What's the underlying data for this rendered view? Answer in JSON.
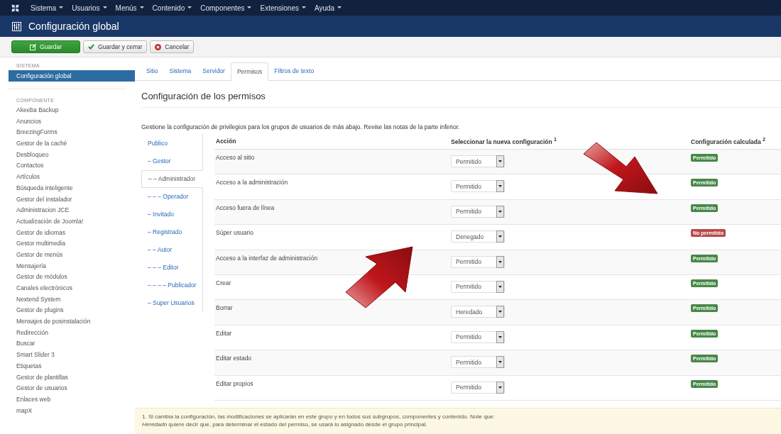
{
  "menu": [
    "Sistema",
    "Usuarios",
    "Menús",
    "Contenido",
    "Componentes",
    "Extensiones",
    "Ayuda"
  ],
  "header": {
    "title": "Configuración global"
  },
  "toolbar": [
    {
      "label": "Guardar",
      "kind": "primary"
    },
    {
      "label": "Guardar y cerrar",
      "kind": "check"
    },
    {
      "label": "Cancelar",
      "kind": "cancel"
    }
  ],
  "sidebar": [
    {
      "heading": "SISTEMA",
      "items": [
        {
          "label": "Configuración global",
          "selected": true
        }
      ]
    },
    {
      "heading": "COMPONENTE",
      "items": [
        {
          "label": "Akeeba Backup",
          "selected": false
        },
        {
          "label": "Anuncios",
          "selected": false
        },
        {
          "label": "BreezingForms",
          "selected": false
        },
        {
          "label": "Gestor de la caché",
          "selected": false
        },
        {
          "label": "Desbloqueo",
          "selected": false
        },
        {
          "label": "Contactos",
          "selected": false
        },
        {
          "label": "Artículos",
          "selected": false
        },
        {
          "label": "Búsqueda inteligente",
          "selected": false
        },
        {
          "label": "Gestor del instalador",
          "selected": false
        },
        {
          "label": "Administracion JCE",
          "selected": false
        },
        {
          "label": "Actualización de Joomla!",
          "selected": false
        },
        {
          "label": "Gestor de idiomas",
          "selected": false
        },
        {
          "label": "Gestor multimedia",
          "selected": false
        },
        {
          "label": "Gestor de menús",
          "selected": false
        },
        {
          "label": "Mensajería",
          "selected": false
        },
        {
          "label": "Gestor de módulos",
          "selected": false
        },
        {
          "label": "Canales electrónicos",
          "selected": false
        },
        {
          "label": "Nextend System",
          "selected": false
        },
        {
          "label": "Gestor de plugins",
          "selected": false
        },
        {
          "label": "Mensajes de posinstalación",
          "selected": false
        },
        {
          "label": "Redirección",
          "selected": false
        },
        {
          "label": "Buscar",
          "selected": false
        },
        {
          "label": "Smart Slider 3",
          "selected": false
        },
        {
          "label": "Etiquetas",
          "selected": false
        },
        {
          "label": "Gestor de plantillas",
          "selected": false
        },
        {
          "label": "Gestor de usuarios",
          "selected": false
        },
        {
          "label": "Enlaces web",
          "selected": false
        },
        {
          "label": "mapX",
          "selected": false
        }
      ]
    }
  ],
  "tabs": [
    {
      "label": "Sitio",
      "selected": false
    },
    {
      "label": "Sistema",
      "selected": false
    },
    {
      "label": "Servidor",
      "selected": false
    },
    {
      "label": "Permisos",
      "selected": true
    },
    {
      "label": "Filtros de texto",
      "selected": false
    }
  ],
  "section_title": "Configuración de los permisos",
  "description": "Gestione la configuración de privilegios para los grupos de usuarios de más abajo. Revise las notas de la parte inferior.",
  "groups": [
    {
      "label": "Publico",
      "selected": false
    },
    {
      "label": "– Gestor",
      "selected": false
    },
    {
      "label": "– – Administrador",
      "selected": true
    },
    {
      "label": "– – – Operador",
      "selected": false
    },
    {
      "label": "– Invitado",
      "selected": false
    },
    {
      "label": "– Registrado",
      "selected": false
    },
    {
      "label": "– – Autor",
      "selected": false
    },
    {
      "label": "– – – Editor",
      "selected": false
    },
    {
      "label": "– – – – Publicador",
      "selected": false
    },
    {
      "label": "– Super Usuarios",
      "selected": false
    }
  ],
  "table": {
    "columns": [
      "Acción",
      "Seleccionar la nueva configuración $^{1}$",
      "Configuración calculada $^{2}$"
    ],
    "rows": [
      {
        "action": "Acceso al sitio",
        "setting": "Permitido",
        "calculated": "Permitido",
        "kind": "allowed"
      },
      {
        "action": "Acceso a la administración",
        "setting": "Permitido",
        "calculated": "Permitido",
        "kind": "allowed"
      },
      {
        "action": "Acceso fuera de línea",
        "setting": "Permitido",
        "calculated": "Permitido",
        "kind": "allowed"
      },
      {
        "action": "Súper usuario",
        "setting": "Denegado",
        "calculated": "No permitido",
        "kind": "denied"
      },
      {
        "action": "Acceso a la interfaz de administración",
        "setting": "Permitido",
        "calculated": "Permitido",
        "kind": "allowed"
      },
      {
        "action": "Crear",
        "setting": "Permitido",
        "calculated": "Permitido",
        "kind": "allowed"
      },
      {
        "action": "Borrar",
        "setting": "Heredado",
        "calculated": "Permitido",
        "kind": "allowed"
      },
      {
        "action": "Editar",
        "setting": "Permitido",
        "calculated": "Permitido",
        "kind": "allowed"
      },
      {
        "action": "Editar estado",
        "setting": "Permitido",
        "calculated": "Permitido",
        "kind": "allowed"
      },
      {
        "action": "Editar propios",
        "setting": "Permitido",
        "calculated": "Permitido",
        "kind": "allowed"
      }
    ]
  },
  "notes": [
    "1. Si cambia la configuración, las modificaciones se aplicarán en este grupo y en todos sus subgrupos, componentes y contenido. Note que:",
    "*Heredado* quiere decir que, para determinar el estado del permiso, se usará lo asignado desde el grupo principal."
  ]
}
